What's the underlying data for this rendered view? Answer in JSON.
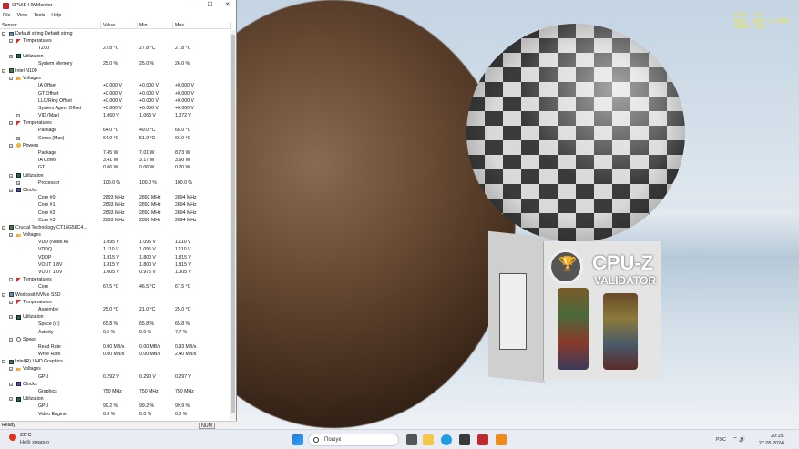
{
  "window": {
    "title": "CPUID HWMonitor",
    "menus": [
      "File",
      "View",
      "Tools",
      "Help"
    ],
    "controls": {
      "minimize": "–",
      "maximize": "☐",
      "close": "✕"
    }
  },
  "columns": [
    "Sensor",
    "Value",
    "Min",
    "Max"
  ],
  "rows": [
    {
      "level": 0,
      "icon": "pc-icon",
      "name": "Default string Default string",
      "tw": "−",
      "v": "",
      "mn": "",
      "mx": ""
    },
    {
      "level": 1,
      "icon": "temperature-icon",
      "name": "Temperatures",
      "tw": "−",
      "v": "",
      "mn": "",
      "mx": ""
    },
    {
      "level": 2,
      "icon": "",
      "name": "TZ00",
      "tw": "",
      "v": "27.8 °C",
      "mn": "27.8 °C",
      "mx": "27.8 °C"
    },
    {
      "level": 1,
      "icon": "utilization-icon",
      "name": "Utilization",
      "tw": "−",
      "v": "",
      "mn": "",
      "mx": ""
    },
    {
      "level": 2,
      "icon": "",
      "name": "System Memory",
      "tw": "",
      "v": "25.0 %",
      "mn": "25.0 %",
      "mx": "26.0 %"
    },
    {
      "level": 0,
      "icon": "chip-icon",
      "name": "Intel N100",
      "tw": "−",
      "v": "",
      "mn": "",
      "mx": ""
    },
    {
      "level": 1,
      "icon": "voltage-icon",
      "name": "Voltages",
      "tw": "−",
      "v": "",
      "mn": "",
      "mx": ""
    },
    {
      "level": 2,
      "icon": "",
      "name": "IA Offset",
      "tw": "",
      "v": "+0.000 V",
      "mn": "+0.000 V",
      "mx": "+0.000 V"
    },
    {
      "level": 2,
      "icon": "",
      "name": "GT Offset",
      "tw": "",
      "v": "+0.000 V",
      "mn": "+0.000 V",
      "mx": "+0.000 V"
    },
    {
      "level": 2,
      "icon": "",
      "name": "LLC/Ring Offset",
      "tw": "",
      "v": "+0.000 V",
      "mn": "+0.000 V",
      "mx": "+0.000 V"
    },
    {
      "level": 2,
      "icon": "",
      "name": "System Agent Offset",
      "tw": "",
      "v": "+0.000 V",
      "mn": "+0.000 V",
      "mx": "+0.000 V"
    },
    {
      "level": 2,
      "icon": "",
      "name": "VID (Max)",
      "tw": "+",
      "v": "1.060 V",
      "mn": "1.063 V",
      "mx": "1.072 V"
    },
    {
      "level": 1,
      "icon": "temperature-icon",
      "name": "Temperatures",
      "tw": "−",
      "v": "",
      "mn": "",
      "mx": ""
    },
    {
      "level": 2,
      "icon": "",
      "name": "Package",
      "tw": "",
      "v": "64.0 °C",
      "mn": "49.0 °C",
      "mx": "66.0 °C"
    },
    {
      "level": 2,
      "icon": "",
      "name": "Cores (Max)",
      "tw": "+",
      "v": "64.0 °C",
      "mn": "51.0 °C",
      "mx": "66.0 °C"
    },
    {
      "level": 1,
      "icon": "power-icon",
      "name": "Powers",
      "tw": "−",
      "v": "",
      "mn": "",
      "mx": ""
    },
    {
      "level": 2,
      "icon": "",
      "name": "Package",
      "tw": "",
      "v": "7.45 W",
      "mn": "7.01 W",
      "mx": "8.73 W"
    },
    {
      "level": 2,
      "icon": "",
      "name": "IA Cores",
      "tw": "",
      "v": "3.41 W",
      "mn": "3.17 W",
      "mx": "3.60 W"
    },
    {
      "level": 2,
      "icon": "",
      "name": "GT",
      "tw": "",
      "v": "0.06 W",
      "mn": "0.06 W",
      "mx": "0.20 W"
    },
    {
      "level": 1,
      "icon": "utilization-icon",
      "name": "Utilization",
      "tw": "−",
      "v": "",
      "mn": "",
      "mx": ""
    },
    {
      "level": 2,
      "icon": "",
      "name": "Processor",
      "tw": "+",
      "v": "100.0 %",
      "mn": "100.0 %",
      "mx": "100.0 %"
    },
    {
      "level": 1,
      "icon": "clock-icon",
      "name": "Clocks",
      "tw": "−",
      "v": "",
      "mn": "",
      "mx": ""
    },
    {
      "level": 2,
      "icon": "",
      "name": "Core #0",
      "tw": "",
      "v": "2893 MHz",
      "mn": "2892 MHz",
      "mx": "2894 MHz"
    },
    {
      "level": 2,
      "icon": "",
      "name": "Core #1",
      "tw": "",
      "v": "2893 MHz",
      "mn": "2892 MHz",
      "mx": "2894 MHz"
    },
    {
      "level": 2,
      "icon": "",
      "name": "Core #2",
      "tw": "",
      "v": "2893 MHz",
      "mn": "2892 MHz",
      "mx": "2894 MHz"
    },
    {
      "level": 2,
      "icon": "",
      "name": "Core #3",
      "tw": "",
      "v": "2893 MHz",
      "mn": "2892 MHz",
      "mx": "2894 MHz"
    },
    {
      "level": 0,
      "icon": "chip-icon",
      "name": "Crucial Technology CT16G56C4...",
      "tw": "−",
      "v": "",
      "mn": "",
      "mx": ""
    },
    {
      "level": 1,
      "icon": "voltage-icon",
      "name": "Voltages",
      "tw": "−",
      "v": "",
      "mn": "",
      "mx": ""
    },
    {
      "level": 2,
      "icon": "",
      "name": "VDD (Node A)",
      "tw": "",
      "v": "1.095 V",
      "mn": "1.095 V",
      "mx": "1.110 V"
    },
    {
      "level": 2,
      "icon": "",
      "name": "VDDQ",
      "tw": "",
      "v": "1.110 V",
      "mn": "1.095 V",
      "mx": "1.110 V"
    },
    {
      "level": 2,
      "icon": "",
      "name": "VDDP",
      "tw": "",
      "v": "1.815 V",
      "mn": "1.800 V",
      "mx": "1.815 V"
    },
    {
      "level": 2,
      "icon": "",
      "name": "VOUT 1.8V",
      "tw": "",
      "v": "1.815 V",
      "mn": "1.800 V",
      "mx": "1.815 V"
    },
    {
      "level": 2,
      "icon": "",
      "name": "VOUT 1.0V",
      "tw": "",
      "v": "1.005 V",
      "mn": "0.975 V",
      "mx": "1.005 V"
    },
    {
      "level": 1,
      "icon": "temperature-icon",
      "name": "Temperatures",
      "tw": "−",
      "v": "",
      "mn": "",
      "mx": ""
    },
    {
      "level": 2,
      "icon": "",
      "name": "Core",
      "tw": "",
      "v": "67.5 °C",
      "mn": "46.5 °C",
      "mx": "67.5 °C"
    },
    {
      "level": 0,
      "icon": "drive-icon",
      "name": "Wodposit NVMe SSD",
      "tw": "−",
      "v": "",
      "mn": "",
      "mx": ""
    },
    {
      "level": 1,
      "icon": "temperature-icon",
      "name": "Temperatures",
      "tw": "−",
      "v": "",
      "mn": "",
      "mx": ""
    },
    {
      "level": 2,
      "icon": "",
      "name": "Assembly",
      "tw": "",
      "v": "25.0 °C",
      "mn": "21.0 °C",
      "mx": "25.0 °C"
    },
    {
      "level": 1,
      "icon": "utilization-icon",
      "name": "Utilization",
      "tw": "−",
      "v": "",
      "mn": "",
      "mx": ""
    },
    {
      "level": 2,
      "icon": "",
      "name": "Space (c:)",
      "tw": "",
      "v": "65.8 %",
      "mn": "65.8 %",
      "mx": "65.8 %"
    },
    {
      "level": 2,
      "icon": "",
      "name": "Activity",
      "tw": "",
      "v": "0.5 %",
      "mn": "0.0 %",
      "mx": "7.7 %"
    },
    {
      "level": 1,
      "icon": "speed-icon",
      "name": "Speed",
      "tw": "−",
      "v": "",
      "mn": "",
      "mx": ""
    },
    {
      "level": 2,
      "icon": "",
      "name": "Read Rate",
      "tw": "",
      "v": "0.00 MB/s",
      "mn": "0.00 MB/s",
      "mx": "0.93 MB/s"
    },
    {
      "level": 2,
      "icon": "",
      "name": "Write Rate",
      "tw": "",
      "v": "0.00 MB/s",
      "mn": "0.00 MB/s",
      "mx": "2.40 MB/s"
    },
    {
      "level": 0,
      "icon": "gpu-icon",
      "name": "Intel(R) UHD Graphics",
      "tw": "−",
      "v": "",
      "mn": "",
      "mx": ""
    },
    {
      "level": 1,
      "icon": "voltage-icon",
      "name": "Voltages",
      "tw": "−",
      "v": "",
      "mn": "",
      "mx": ""
    },
    {
      "level": 2,
      "icon": "",
      "name": "GPU",
      "tw": "",
      "v": "0.292 V",
      "mn": "0.290 V",
      "mx": "0.297 V"
    },
    {
      "level": 1,
      "icon": "clock-icon",
      "name": "Clocks",
      "tw": "−",
      "v": "",
      "mn": "",
      "mx": ""
    },
    {
      "level": 2,
      "icon": "",
      "name": "Graphics",
      "tw": "",
      "v": "750 MHz",
      "mn": "750 MHz",
      "mx": "750 MHz"
    },
    {
      "level": 1,
      "icon": "utilization-icon",
      "name": "Utilization",
      "tw": "−",
      "v": "",
      "mn": "",
      "mx": ""
    },
    {
      "level": 2,
      "icon": "",
      "name": "GPU",
      "tw": "",
      "v": "99.2 %",
      "mn": "99.2 %",
      "mx": "99.9 %"
    },
    {
      "level": 2,
      "icon": "",
      "name": "Video Engine",
      "tw": "",
      "v": "0.0 %",
      "mn": "0.0 %",
      "mx": "0.0 %"
    }
  ],
  "status": {
    "text": "Ready",
    "num": "NUM"
  },
  "benchmark": {
    "overlay": "FPS: 2.3\nFBO: 1920 x 1080\nMSAA: 16x",
    "logo_title": "CPU-Z",
    "logo_sub": "VALIDATOR"
  },
  "taskbar": {
    "weather_temp": "22°C",
    "weather_desc": "Небі хмарно",
    "search_placeholder": "Пошук",
    "lang": "РУС",
    "time": "20:15",
    "date": "27.05.2024"
  },
  "colors": {
    "accent": "#c1272d",
    "overlay_text": "#f2e92a",
    "taskbar": "#e9edf3"
  }
}
